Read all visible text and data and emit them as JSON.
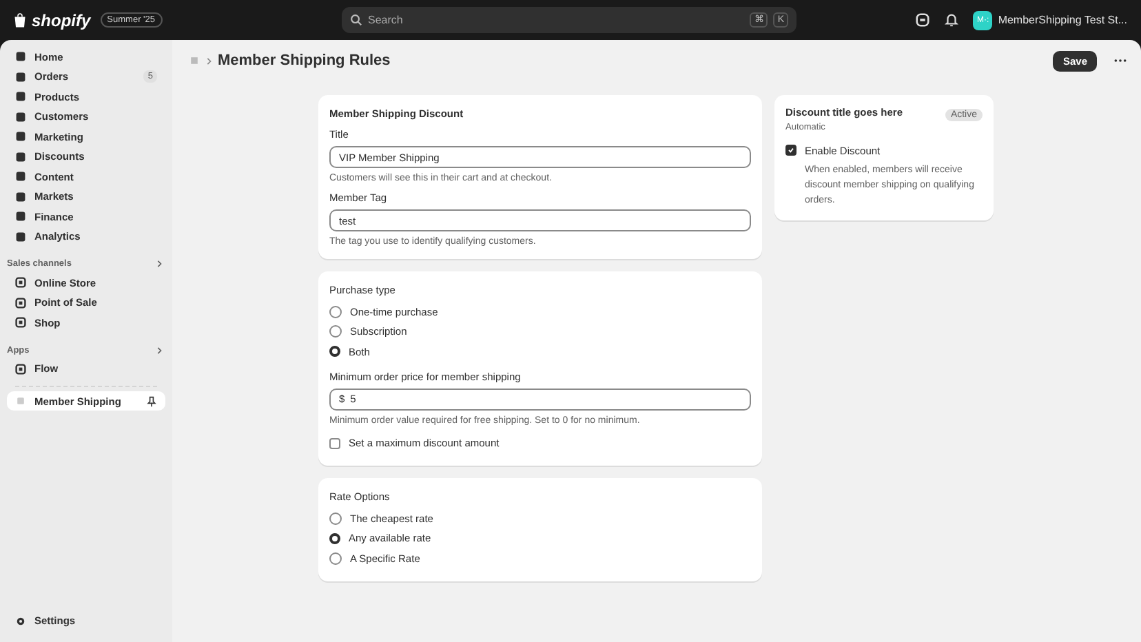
{
  "topbar": {
    "brand": "shopify",
    "edition": "Summer '25",
    "search": {
      "placeholder": "Search",
      "keys": [
        "⌘",
        "K"
      ]
    },
    "store": {
      "initials": "M·:",
      "name": "MemberShipping Test St..."
    }
  },
  "sidebar": {
    "items": [
      {
        "label": "Home",
        "selected": false
      },
      {
        "label": "Orders",
        "badge": "5",
        "selected": false
      },
      {
        "label": "Products",
        "selected": false
      },
      {
        "label": "Customers",
        "selected": false
      },
      {
        "label": "Marketing",
        "selected": false
      },
      {
        "label": "Discounts",
        "selected": false
      },
      {
        "label": "Content",
        "selected": false
      },
      {
        "label": "Markets",
        "selected": false
      },
      {
        "label": "Finance",
        "selected": false
      },
      {
        "label": "Analytics",
        "selected": false
      }
    ],
    "sections": [
      {
        "title": "Sales channels",
        "items": [
          {
            "label": "Online Store",
            "selected": false
          },
          {
            "label": "Point of Sale",
            "selected": false
          },
          {
            "label": "Shop",
            "selected": false
          }
        ]
      },
      {
        "title": "Apps",
        "items": [
          {
            "label": "Flow",
            "selected": false
          }
        ]
      }
    ],
    "pinned": {
      "label": "Member Shipping",
      "selected": true
    },
    "settings": "Settings"
  },
  "page": {
    "title": "Member Shipping Rules",
    "save": "Save",
    "discount_card": {
      "heading": "Member Shipping Discount",
      "fields": [
        {
          "label": "Title",
          "value": "VIP Member Shipping",
          "help": "Customers will see this in their cart and at checkout."
        },
        {
          "label": "Member Tag",
          "value": "test",
          "help": "The tag you use to identify qualifying customers."
        }
      ]
    },
    "purchase_card": {
      "heading": "Purchase type",
      "options": [
        {
          "label": "One-time purchase",
          "selected": false
        },
        {
          "label": "Subscription",
          "selected": false
        },
        {
          "label": "Both",
          "selected": true
        }
      ],
      "min_price": {
        "label": "Minimum order price for member shipping",
        "prefix": "$",
        "value": "5",
        "help": "Minimum order value required for free shipping. Set to 0 for no minimum."
      },
      "max_discount": {
        "label": "Set a maximum discount amount",
        "checked": false
      }
    },
    "rate_card": {
      "heading": "Rate Options",
      "options": [
        {
          "label": "The cheapest rate",
          "selected": false
        },
        {
          "label": "Any available rate",
          "selected": true
        },
        {
          "label": "A Specific Rate",
          "selected": false
        }
      ]
    },
    "summary": {
      "title": "Discount title goes here",
      "status": "Active",
      "method": "Automatic",
      "enable": {
        "label": "Enable Discount",
        "checked": true,
        "help": "When enabled, members will receive discount member shipping on qualifying orders."
      }
    }
  }
}
